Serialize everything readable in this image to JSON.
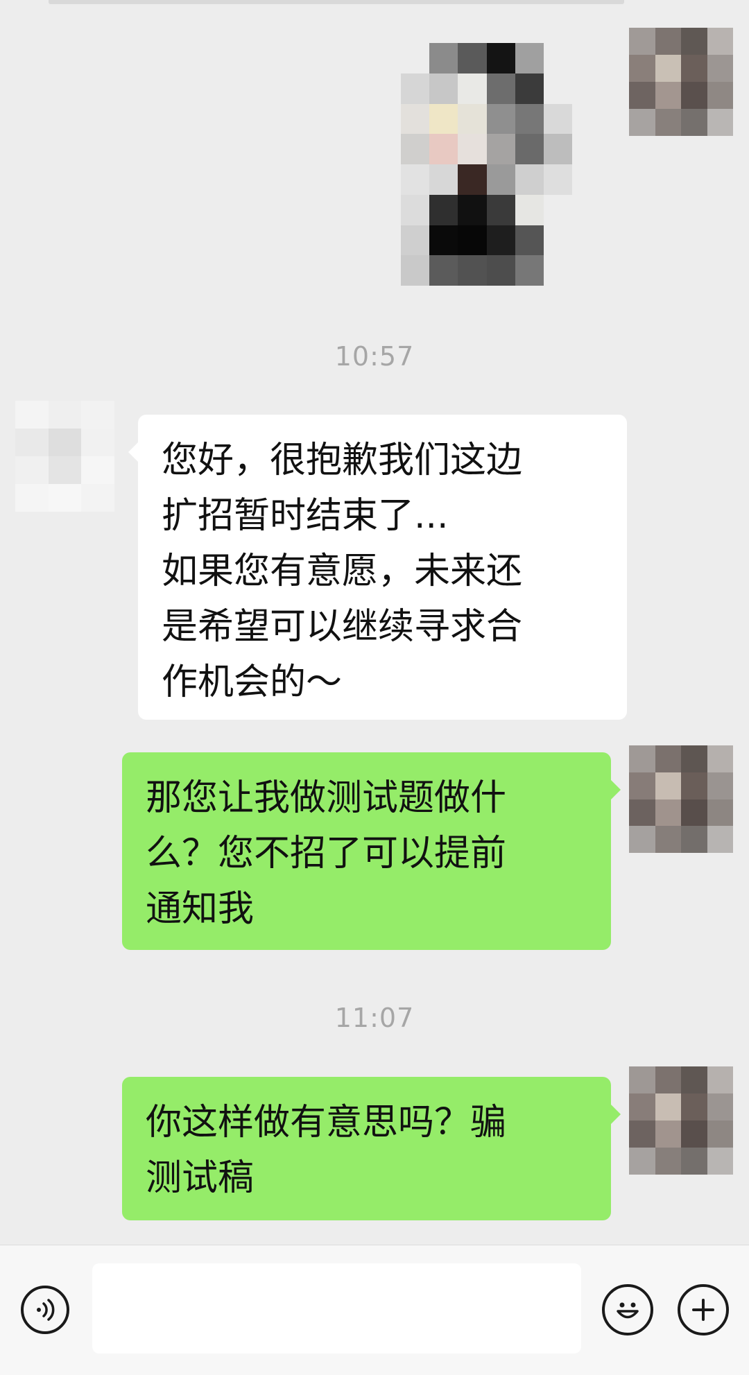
{
  "chat": {
    "messages": [
      {
        "type": "image",
        "side": "right"
      },
      {
        "type": "timestamp",
        "text": "10:57"
      },
      {
        "type": "text",
        "side": "left",
        "text": "您好，很抱歉我们这边扩招暂时结束了...\n如果您有意愿，未来还是希望可以继续寻求合作机会的～"
      },
      {
        "type": "text",
        "side": "right",
        "text": "那您让我做测试题做什么？您不招了可以提前通知我"
      },
      {
        "type": "timestamp",
        "text": "11:07"
      },
      {
        "type": "text",
        "side": "right",
        "text": "你这样做有意思吗？骗测试稿"
      }
    ]
  },
  "timestamps": {
    "first": "10:57",
    "second": "11:07"
  },
  "bubbles": {
    "incoming_1": "您好，很抱歉我们这边\n扩招暂时结束了...\n如果您有意愿，未来还\n是希望可以继续寻求合\n作机会的～",
    "outgoing_1": "那您让我做测试题做什\n么？您不招了可以提前\n通知我",
    "outgoing_2": "你这样做有意思吗？骗\n测试稿"
  },
  "input": {
    "value": "",
    "placeholder": ""
  },
  "icons": {
    "voice": "voice-icon",
    "emoji": "emoji-icon",
    "plus": "plus-icon"
  },
  "colors": {
    "background": "#ededed",
    "incoming_bubble": "#ffffff",
    "outgoing_bubble": "#95ec69",
    "timestamp_text": "#a6a6a6"
  }
}
